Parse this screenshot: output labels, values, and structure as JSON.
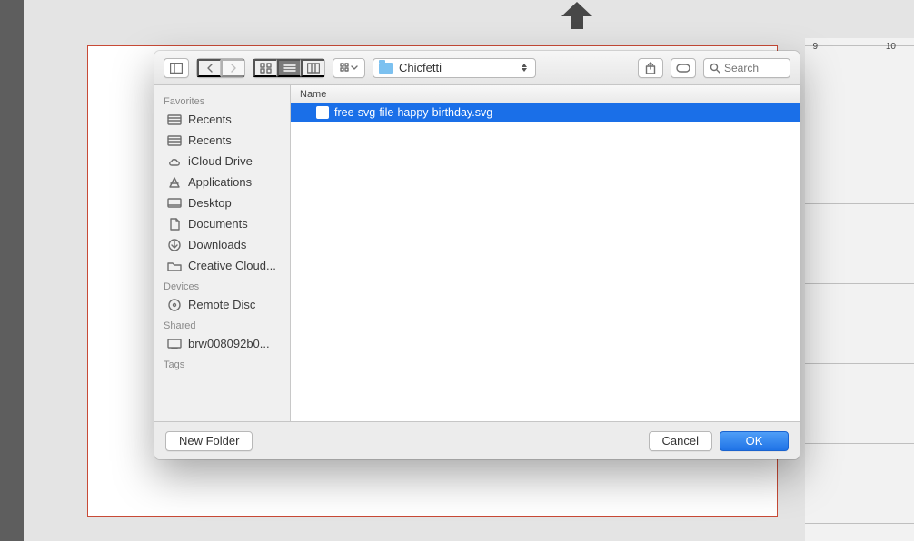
{
  "background": {
    "ruler_9": "9",
    "ruler_10": "10"
  },
  "toolbar": {
    "path_current": "Chicfetti",
    "search_placeholder": "Search"
  },
  "sidebar": {
    "favorites_header": "Favorites",
    "favorites": [
      {
        "icon": "recents-icon",
        "label": "Recents"
      },
      {
        "icon": "recents-icon",
        "label": "Recents"
      },
      {
        "icon": "icloud-icon",
        "label": "iCloud Drive"
      },
      {
        "icon": "applications-icon",
        "label": "Applications"
      },
      {
        "icon": "desktop-icon",
        "label": "Desktop"
      },
      {
        "icon": "documents-icon",
        "label": "Documents"
      },
      {
        "icon": "downloads-icon",
        "label": "Downloads"
      },
      {
        "icon": "folder-icon",
        "label": "Creative Cloud..."
      }
    ],
    "devices_header": "Devices",
    "devices": [
      {
        "icon": "disc-icon",
        "label": "Remote Disc"
      }
    ],
    "shared_header": "Shared",
    "shared": [
      {
        "icon": "computer-icon",
        "label": "brw008092b0..."
      }
    ],
    "tags_header": "Tags"
  },
  "filelist": {
    "column_name": "Name",
    "rows": [
      {
        "name": "free-svg-file-happy-birthday.svg",
        "selected": true
      }
    ]
  },
  "footer": {
    "new_folder": "New Folder",
    "cancel": "Cancel",
    "ok": "OK"
  }
}
